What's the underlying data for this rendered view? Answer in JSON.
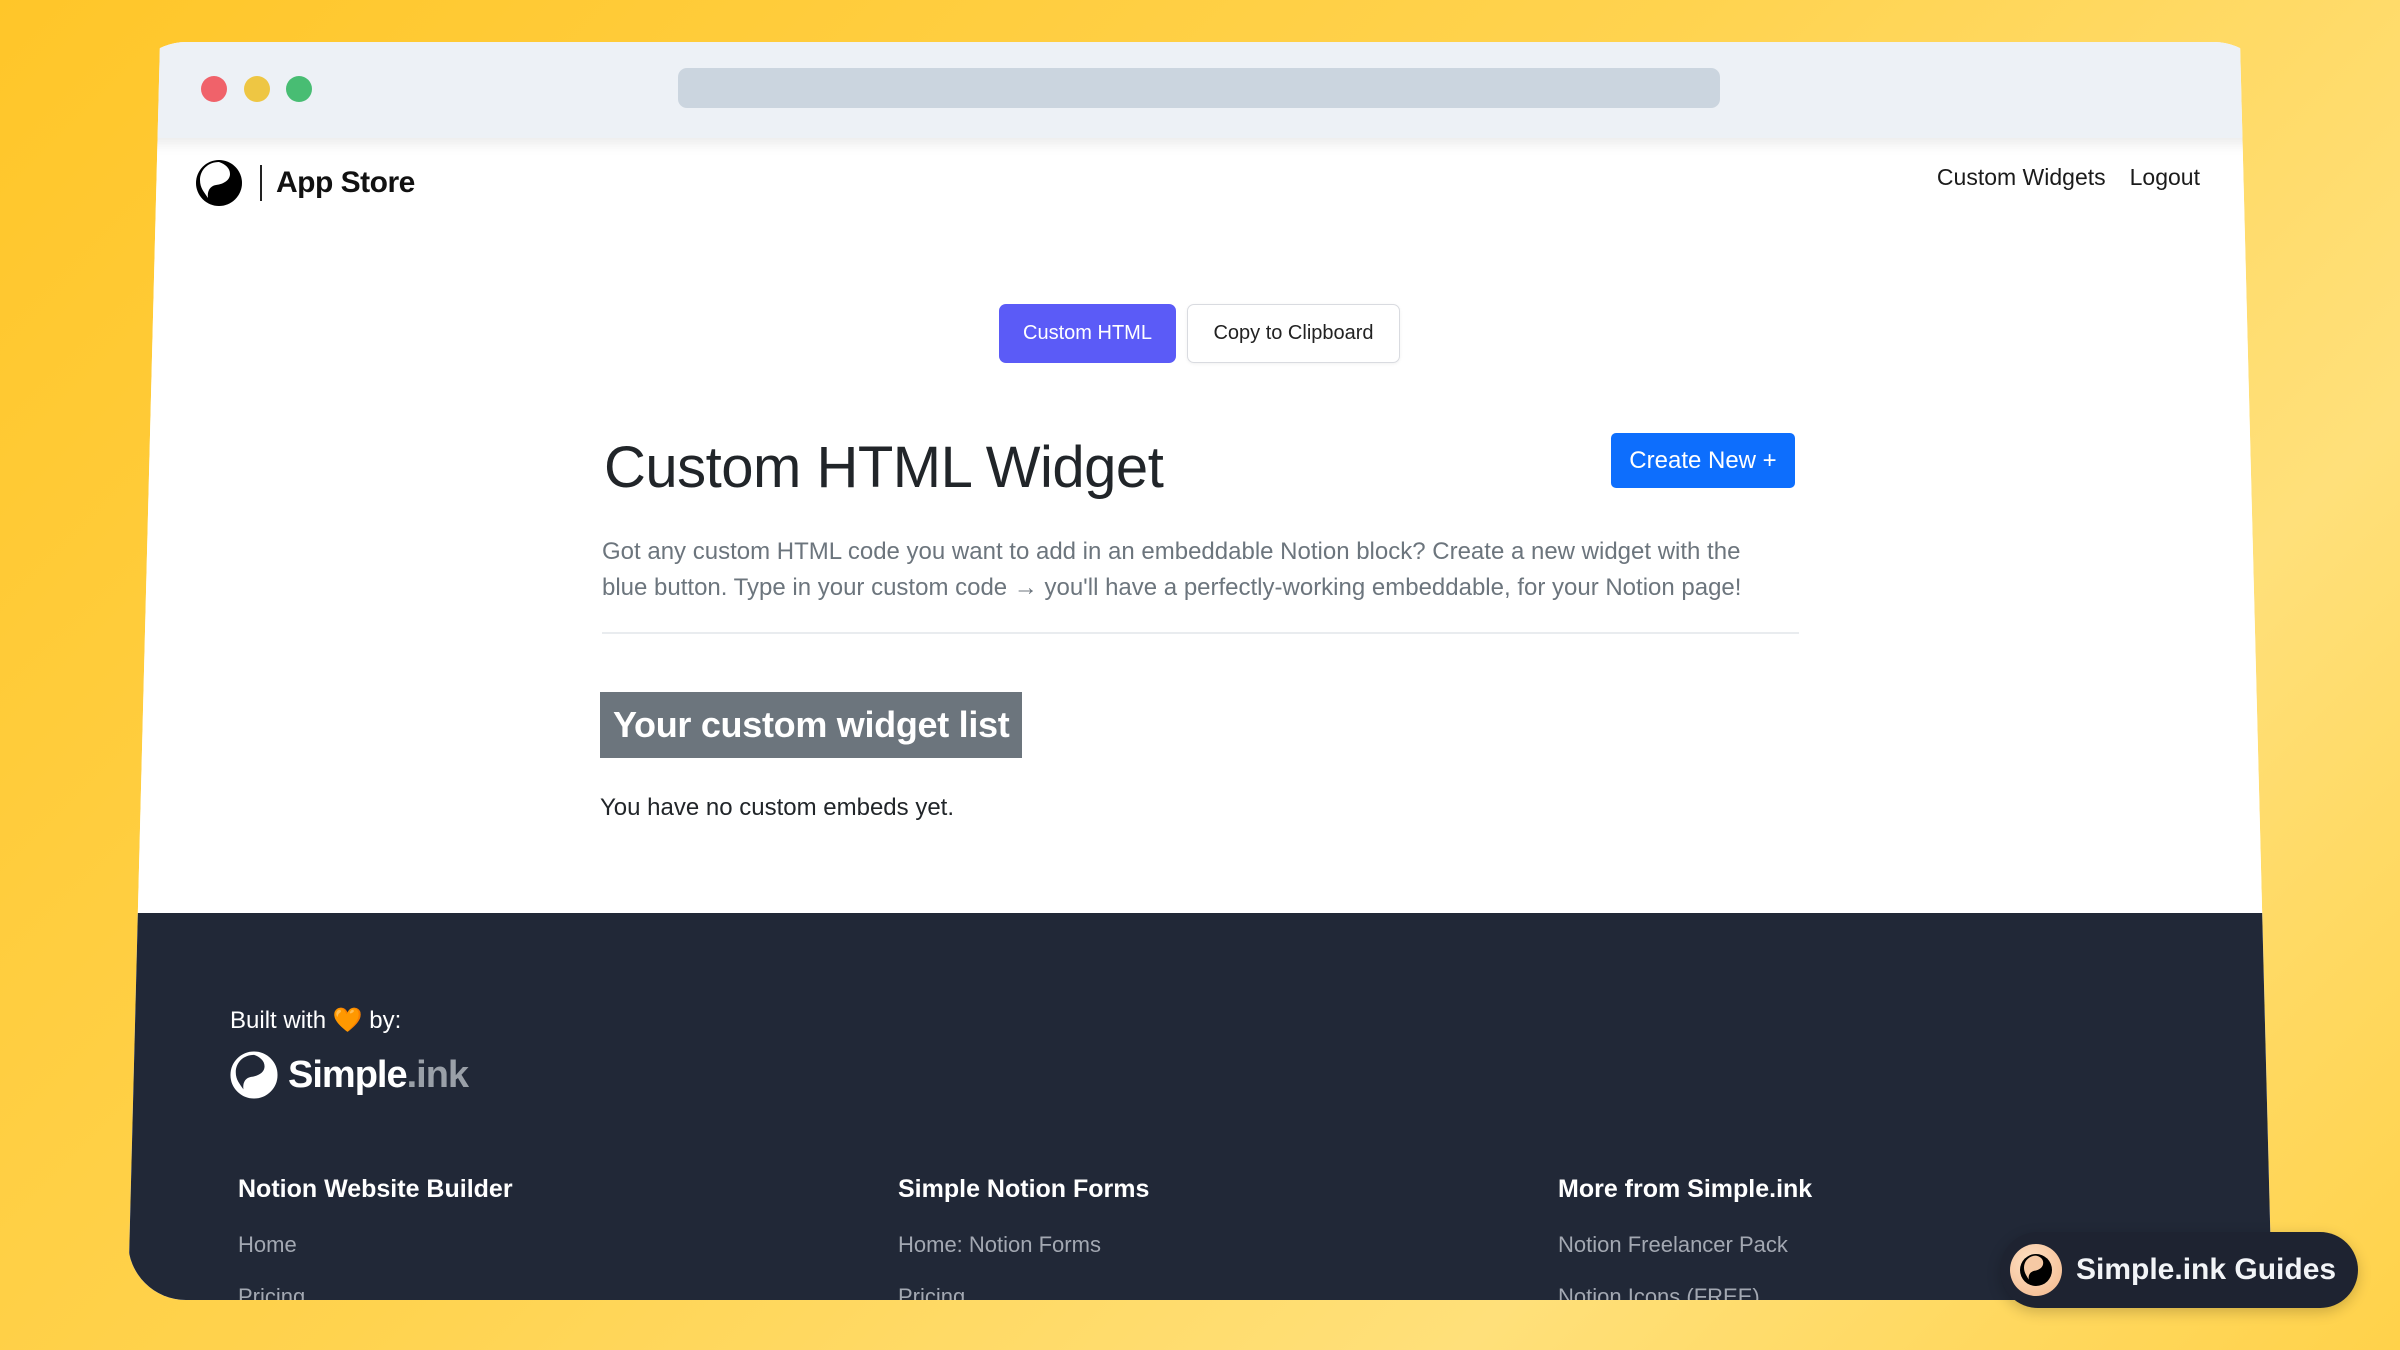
{
  "browser": {
    "traffic_lights": [
      "close",
      "minimize",
      "maximize"
    ],
    "colors": {
      "close": "#f0626a",
      "minimize": "#eec643",
      "maximize": "#48bd73"
    }
  },
  "nav": {
    "logo_text": "App Store",
    "links": [
      {
        "label": "Custom Widgets"
      },
      {
        "label": "Logout"
      }
    ]
  },
  "toolbar": {
    "custom_html_label": "Custom HTML",
    "copy_label": "Copy to Clipboard"
  },
  "main": {
    "title": "Custom HTML Widget",
    "create_button_label": "Create New +",
    "description_line1": "Got any custom HTML code you want to add in an embeddable Notion block? Create a new widget with the",
    "description_line2": "blue button. Type in your custom code → you'll have a perfectly-working embeddable, for your Notion page!",
    "list_heading": "Your custom widget list",
    "empty_message": "You have no custom embeds yet."
  },
  "footer": {
    "built_prefix": "Built with",
    "built_heart": "🧡",
    "built_suffix": "by:",
    "brand_main": "Simple",
    "brand_ink": ".ink",
    "columns": [
      {
        "heading": "Notion Website Builder",
        "links": [
          "Home",
          "Pricing"
        ]
      },
      {
        "heading": "Simple Notion Forms",
        "links": [
          "Home: Notion Forms",
          "Pricing"
        ]
      },
      {
        "heading": "More from Simple.ink",
        "links": [
          "Notion Freelancer Pack",
          "Notion Icons (FREE)"
        ]
      }
    ]
  },
  "guides_button": {
    "label": "Simple.ink Guides"
  },
  "colors": {
    "primary_purple": "#5b5bf7",
    "create_blue": "#0d6efd",
    "badge_gray": "#6c757d",
    "footer_bg": "#212837",
    "background_yellow": "#ffd34f"
  }
}
